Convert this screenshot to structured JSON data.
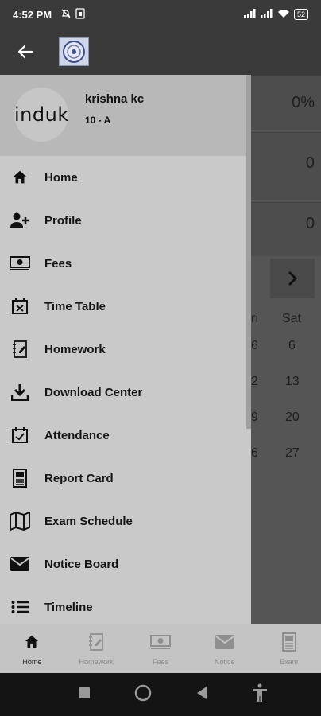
{
  "status_bar": {
    "time": "4:52 PM",
    "battery": "52",
    "icons": [
      "mute-icon",
      "sim-icon",
      "signal-icon",
      "signal-icon",
      "wifi-icon",
      "battery-icon"
    ]
  },
  "app_bar": {
    "back_icon": "arrow-left-icon",
    "logo_icon": "school-logo-icon"
  },
  "background": {
    "values": [
      "0%",
      "0",
      "0"
    ],
    "calendar": {
      "headers": [
        "ri",
        "Sat"
      ],
      "rows": [
        [
          "6",
          "6"
        ],
        [
          "2",
          "13"
        ],
        [
          "9",
          "20"
        ],
        [
          "6",
          "27"
        ]
      ]
    }
  },
  "drawer": {
    "avatar_text": "induk",
    "user_name": "krishna kc",
    "user_class": "10 - A",
    "items": [
      {
        "label": "Home",
        "icon": "home-icon"
      },
      {
        "label": "Profile",
        "icon": "add-person-icon"
      },
      {
        "label": "Fees",
        "icon": "money-icon"
      },
      {
        "label": "Time Table",
        "icon": "calendar-x-icon"
      },
      {
        "label": "Homework",
        "icon": "notebook-icon"
      },
      {
        "label": "Download Center",
        "icon": "download-icon"
      },
      {
        "label": "Attendance",
        "icon": "calendar-check-icon"
      },
      {
        "label": "Report Card",
        "icon": "report-card-icon"
      },
      {
        "label": "Exam Schedule",
        "icon": "map-icon"
      },
      {
        "label": "Notice Board",
        "icon": "mail-icon"
      },
      {
        "label": "Timeline",
        "icon": "list-icon"
      }
    ]
  },
  "bottom_nav": [
    {
      "label": "Home",
      "icon": "home-icon",
      "active": true
    },
    {
      "label": "Homework",
      "icon": "notebook-icon",
      "active": false
    },
    {
      "label": "Fees",
      "icon": "money-icon",
      "active": false
    },
    {
      "label": "Notice",
      "icon": "mail-icon",
      "active": false
    },
    {
      "label": "Exam",
      "icon": "report-card-icon",
      "active": false
    }
  ],
  "system_nav": [
    "recents-icon",
    "home-circle-icon",
    "back-triangle-icon",
    "accessibility-icon"
  ]
}
